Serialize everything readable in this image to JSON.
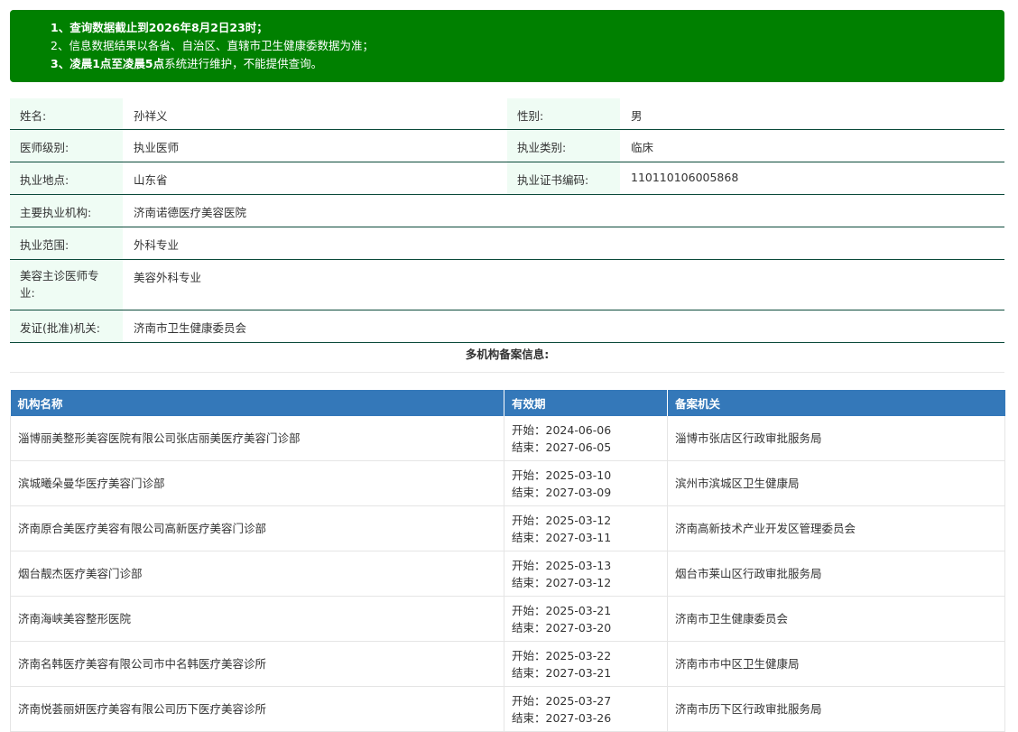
{
  "notice": {
    "line1_prefix": "1、",
    "line1_bold": "查询数据截止到2026年8月2日23时；",
    "line2": "2、信息数据结果以各省、自治区、直辖市卫生健康委数据为准；",
    "line3_prefix": "3、",
    "line3_bold": "凌晨1点至凌晨5点",
    "line3_rest": "系统进行维护，不能提供查询。"
  },
  "info": {
    "name_label": "姓名:",
    "name_value": "孙祥义",
    "gender_label": "性别:",
    "gender_value": "男",
    "level_label": "医师级别:",
    "level_value": "执业医师",
    "category_label": "执业类别:",
    "category_value": "临床",
    "location_label": "执业地点:",
    "location_value": "山东省",
    "cert_label": "执业证书编码:",
    "cert_value": "110110106005868",
    "org_label": "主要执业机构:",
    "org_value": "济南诺德医疗美容医院",
    "scope_label": "执业范围:",
    "scope_value": "外科专业",
    "cosmetic_label_1": "美容主诊医师专",
    "cosmetic_label_2": "业:",
    "cosmetic_value": "美容外科专业",
    "issuer_label": "发证(批准)机关:",
    "issuer_value": "济南市卫生健康委员会"
  },
  "multi_title": "多机构备案信息:",
  "table": {
    "headers": [
      "机构名称",
      "有效期",
      "备案机关"
    ],
    "start_prefix": "开始：",
    "end_prefix": "结束：",
    "rows": [
      {
        "org": "淄博丽美整形美容医院有限公司张店丽美医疗美容门诊部",
        "start": "2024-06-06",
        "end": "2027-06-05",
        "authority": "淄博市张店区行政审批服务局"
      },
      {
        "org": "滨城曦朵曼华医疗美容门诊部",
        "start": "2025-03-10",
        "end": "2027-03-09",
        "authority": "滨州市滨城区卫生健康局"
      },
      {
        "org": "济南原合美医疗美容有限公司高新医疗美容门诊部",
        "start": "2025-03-12",
        "end": "2027-03-11",
        "authority": "济南高新技术产业开发区管理委员会"
      },
      {
        "org": "烟台靓杰医疗美容门诊部",
        "start": "2025-03-13",
        "end": "2027-03-12",
        "authority": "烟台市莱山区行政审批服务局"
      },
      {
        "org": "济南海峡美容整形医院",
        "start": "2025-03-21",
        "end": "2027-03-20",
        "authority": "济南市卫生健康委员会"
      },
      {
        "org": "济南名韩医疗美容有限公司市中名韩医疗美容诊所",
        "start": "2025-03-22",
        "end": "2027-03-21",
        "authority": "济南市市中区卫生健康局"
      },
      {
        "org": "济南悦荟丽妍医疗美容有限公司历下医疗美容诊所",
        "start": "2025-03-27",
        "end": "2027-03-26",
        "authority": "济南市历下区行政审批服务局"
      }
    ]
  }
}
